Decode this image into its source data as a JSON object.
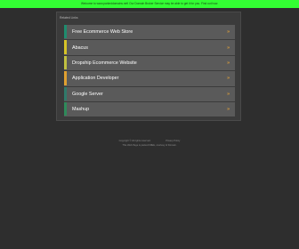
{
  "banner": {
    "text": "Welcome to www.parkeddomains.net! Our Domain Broker Service may be able to get it for you. Find out how."
  },
  "panel": {
    "heading": "Related Links",
    "items": [
      {
        "label": "Free Ecommerce Web Store",
        "arrow": "»",
        "accent": "#1e8c6e"
      },
      {
        "label": "Abacus",
        "arrow": "»",
        "accent": "#d6c428"
      },
      {
        "label": "Dropship Ecommerce Website",
        "arrow": "»",
        "accent": "#c0c040"
      },
      {
        "label": "Application Developer",
        "arrow": "»",
        "accent": "#e0a030"
      },
      {
        "label": "Google Server",
        "arrow": "»",
        "accent": "#2f7a6a"
      },
      {
        "label": "Mashup",
        "arrow": "»",
        "accent": "#2e8a5a"
      }
    ]
  },
  "footer": {
    "copyright": "Copyright © All rights reserved.",
    "privacy": "Privacy Policy",
    "notice": "This Web Page is parked FREE, courtesy of Domain."
  },
  "colors": {
    "banner_bg": "#33ff33",
    "page_bg": "#2e2e2e",
    "item_bg": "#5a5a5a",
    "arrow": "#e0a03a"
  }
}
